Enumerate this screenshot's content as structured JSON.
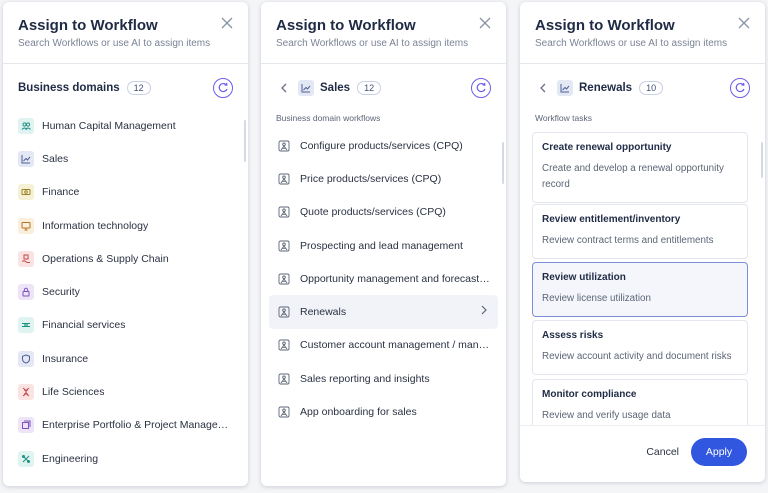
{
  "panels": [
    {
      "title": "Assign to Workflow",
      "subtitle": "Search Workflows or use AI to assign items",
      "section_title": "Business domains",
      "count": "12",
      "items": [
        {
          "label": "Human Capital Management",
          "icon": "people-icon",
          "bg": "#dff3f1",
          "fg": "#1e8f84"
        },
        {
          "label": "Sales",
          "icon": "line-chart-icon",
          "bg": "#e4e8f5",
          "fg": "#4d5f95"
        },
        {
          "label": "Finance",
          "icon": "cash-icon",
          "bg": "#f6f1d5",
          "fg": "#9a8222"
        },
        {
          "label": "Information technology",
          "icon": "monitor-icon",
          "bg": "#fbeedd",
          "fg": "#b07628"
        },
        {
          "label": "Operations & Supply Chain",
          "icon": "hand-box-icon",
          "bg": "#fbe3e3",
          "fg": "#c34646"
        },
        {
          "label": "Security",
          "icon": "lock-icon",
          "bg": "#ede4f8",
          "fg": "#7e52c0"
        },
        {
          "label": "Financial services",
          "icon": "money-icon",
          "bg": "#dff3f1",
          "fg": "#1e8f84"
        },
        {
          "label": "Insurance",
          "icon": "shield-icon",
          "bg": "#e4e8f5",
          "fg": "#4d5f95"
        },
        {
          "label": "Life Sciences",
          "icon": "dna-icon",
          "bg": "#fbe3e3",
          "fg": "#c34646"
        },
        {
          "label": "Enterprise Portfolio & Project Management",
          "icon": "portfolio-icon",
          "bg": "#ede4f8",
          "fg": "#7e52c0"
        },
        {
          "label": "Engineering",
          "icon": "tools-icon",
          "bg": "#dff3f1",
          "fg": "#1e8f84"
        }
      ]
    },
    {
      "title": "Assign to Workflow",
      "subtitle": "Search Workflows or use AI to assign items",
      "crumb": "Sales",
      "count": "12",
      "sublabel": "Business domain workflows",
      "items": [
        {
          "label": "Configure products/services (CPQ)"
        },
        {
          "label": "Price products/services (CPQ)"
        },
        {
          "label": "Quote products/services (CPQ)"
        },
        {
          "label": "Prospecting and lead management"
        },
        {
          "label": "Opportunity management and forecasting"
        },
        {
          "label": "Renewals",
          "active": true
        },
        {
          "label": "Customer account management / manage..."
        },
        {
          "label": "Sales reporting and insights"
        },
        {
          "label": "App onboarding for sales"
        }
      ]
    },
    {
      "title": "Assign to Workflow",
      "subtitle": "Search Workflows or use AI to assign items",
      "crumb": "Renewals",
      "count": "10",
      "sublabel": "Workflow tasks",
      "tasks": [
        {
          "title": "Create renewal opportunity",
          "desc": "Create and develop a renewal opportunity record"
        },
        {
          "title": "Review entitlement/inventory",
          "desc": "Review contract terms and entitlements"
        },
        {
          "title": "Review utilization",
          "desc": "Review license utilization",
          "selected": true
        },
        {
          "title": "Assess risks",
          "desc": "Review account activity and document risks"
        },
        {
          "title": "Monitor compliance",
          "desc": "Review and verify usage data"
        }
      ],
      "cancel_label": "Cancel",
      "apply_label": "Apply"
    }
  ],
  "colors": {
    "accent": "#3157e0",
    "ai": "#6b5cf0"
  }
}
